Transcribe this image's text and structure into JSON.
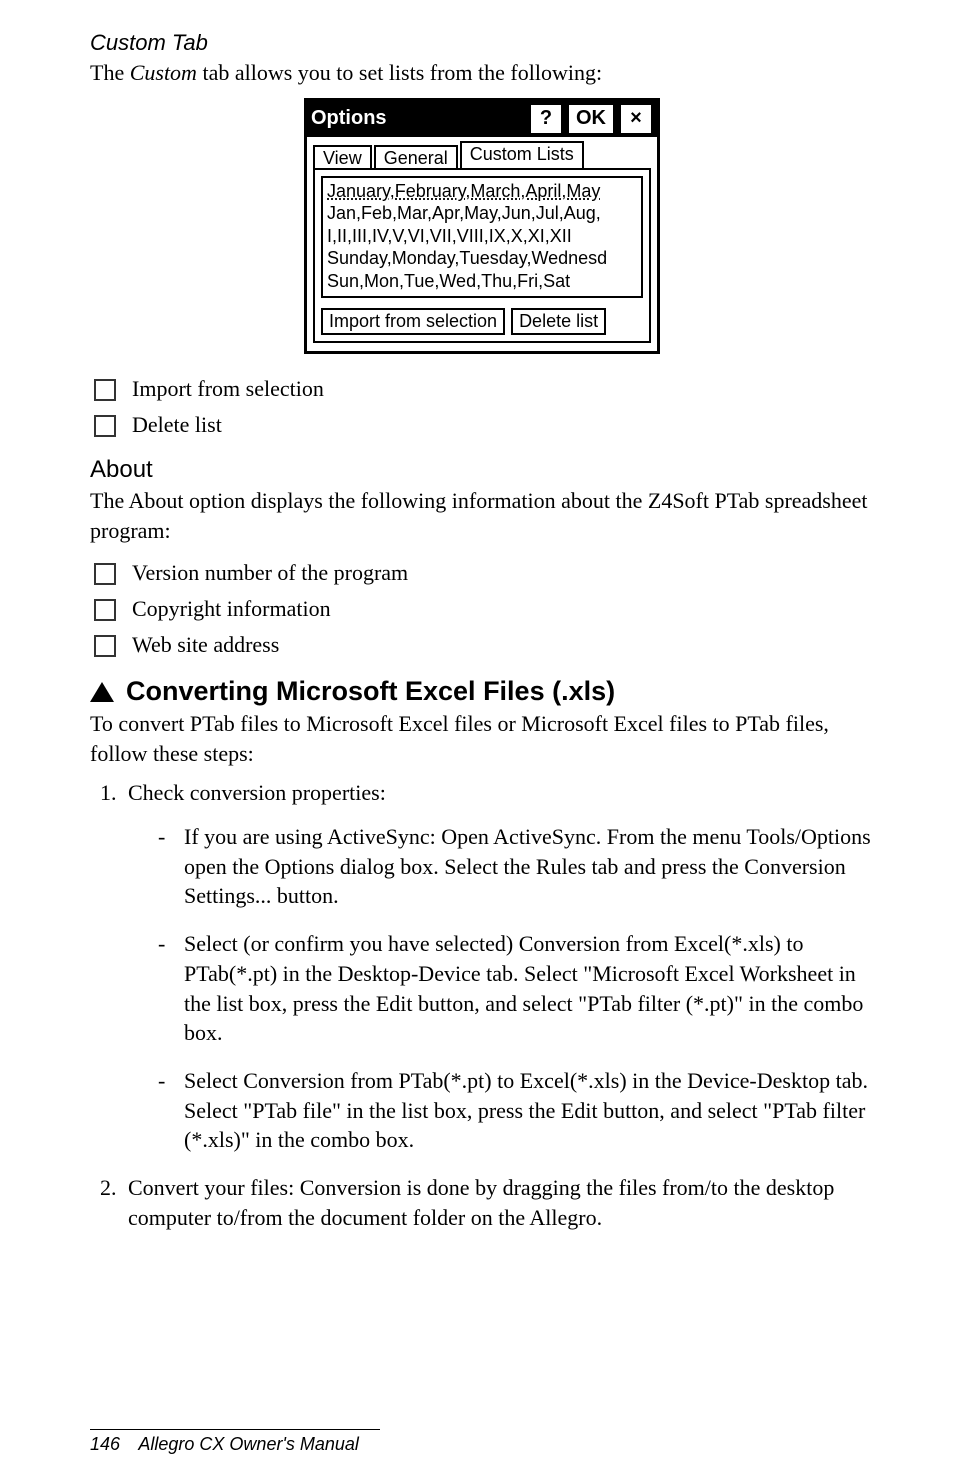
{
  "section": {
    "custom_tab_label": "Custom Tab",
    "custom_tab_intro_pre": "The ",
    "custom_tab_intro_em": "Custom",
    "custom_tab_intro_post": " tab allows you to set lists from the following:"
  },
  "dialog": {
    "title": "Options",
    "help_btn": "?",
    "ok_btn": "OK",
    "close_btn": "×",
    "tabs": {
      "view": "View",
      "general": "General",
      "custom": "Custom Lists"
    },
    "list_items": [
      "January,February,March,April,May",
      "Jan,Feb,Mar,Apr,May,Jun,Jul,Aug,",
      "I,II,III,IV,V,VI,VII,VIII,IX,X,XI,XII",
      "Sunday,Monday,Tuesday,Wednesd",
      "Sun,Mon,Tue,Wed,Thu,Fri,Sat"
    ],
    "import_btn": "Import from selection",
    "delete_btn": "Delete list"
  },
  "post_dialog_bullets": [
    "Import from selection",
    "Delete list"
  ],
  "about": {
    "heading": "About",
    "intro": "The About option displays the following information about the Z4Soft PTab spreadsheet program:",
    "bullets": [
      "Version number of the program",
      "Copyright information",
      "Web site address"
    ]
  },
  "convert": {
    "heading": "Converting Microsoft Excel Files (.xls)",
    "intro": "To convert PTab files to Microsoft Excel files or Microsoft Excel files to PTab files, follow these steps:",
    "step1": "Check conversion properties:",
    "step1_items": [
      "If you are using ActiveSync:  Open ActiveSync. From the menu Tools/Options open the Options dialog box. Select the Rules tab and press the Conversion Settings... button.",
      "Select (or confirm you have selected) Conversion from Excel(*.xls) to PTab(*.pt) in the Desktop-Device tab. Select \"Microsoft Excel Worksheet in the list box, press the Edit  button, and select \"PTab filter (*.pt)\" in the combo box.",
      "Select Conversion from PTab(*.pt) to Excel(*.xls) in the Device-Desktop tab. Select \"PTab file\" in the list box, press the Edit button, and select \"PTab filter (*.xls)\" in the combo box."
    ],
    "step2": "Convert your files: Conversion is done by dragging the files from/to the desktop computer to/from the document folder on the Allegro."
  },
  "footer": {
    "page": "146",
    "title": "Allegro CX Owner's Manual"
  }
}
